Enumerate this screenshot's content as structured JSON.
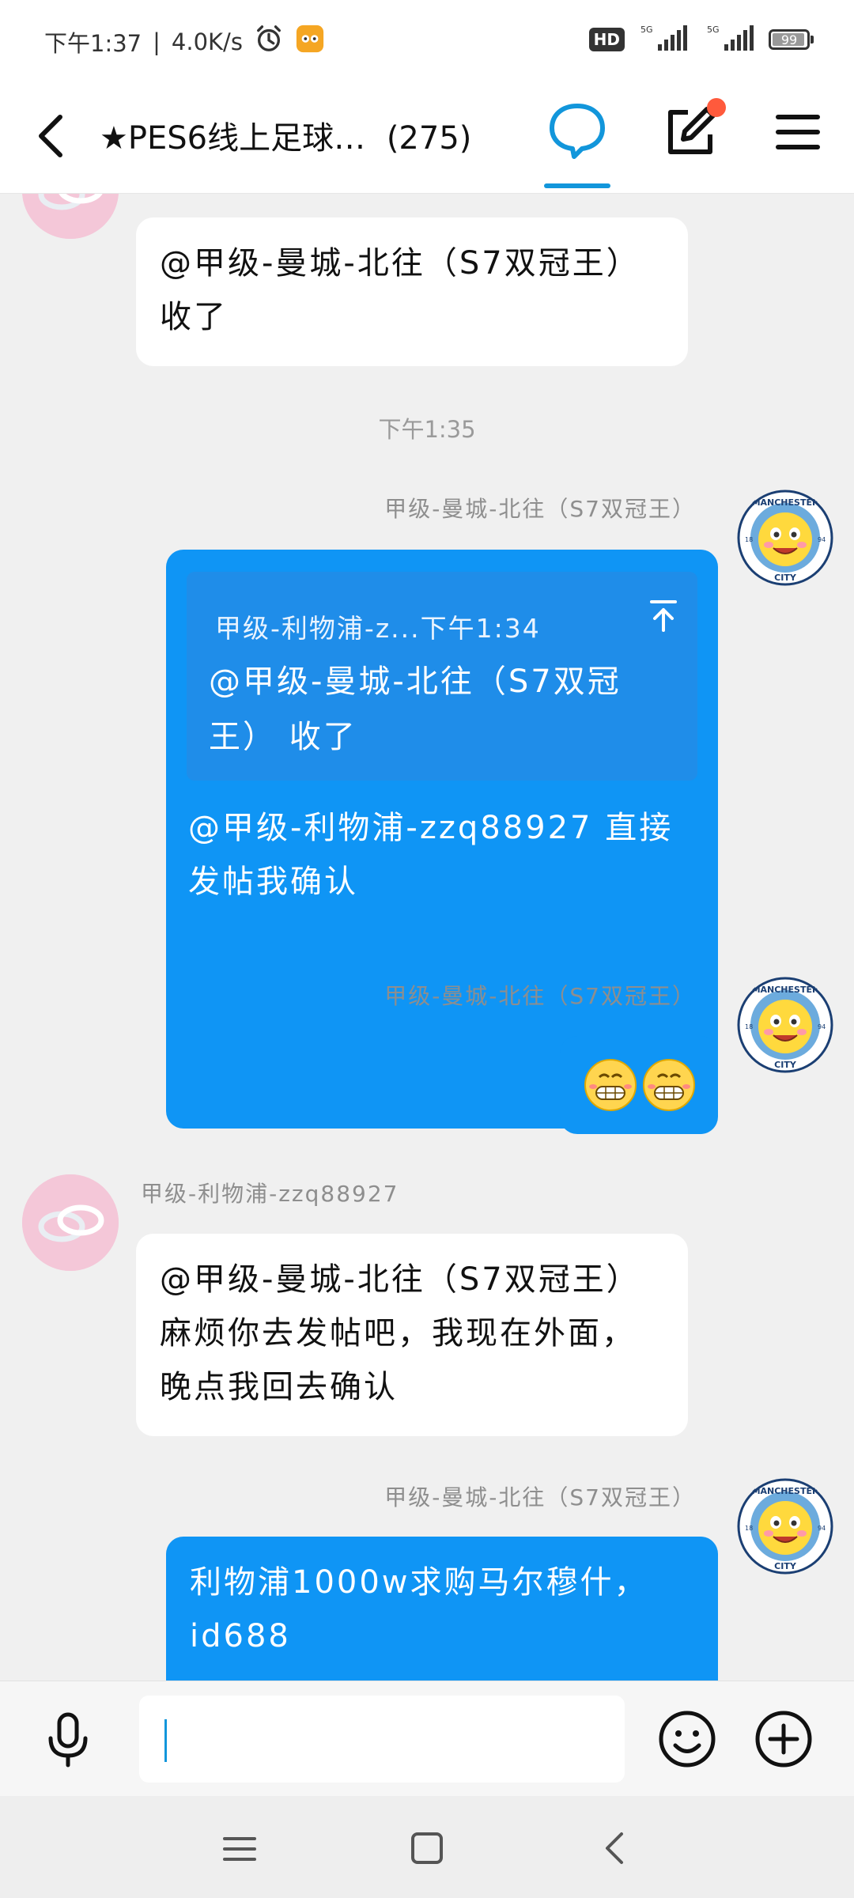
{
  "status_bar": {
    "time": "下午1:37",
    "separator": "|",
    "net_speed": "4.0K/s",
    "hd_label": "HD",
    "sig1_label": "5G",
    "sig2_label": "5G",
    "battery": "99"
  },
  "header": {
    "title": "★PES6线上足球…",
    "member_count": "(275)"
  },
  "messages": {
    "m1": {
      "text": "@甲级-曼城-北往（S7双冠王） 收了"
    },
    "time_divider": "下午1:35",
    "m2": {
      "sender": "甲级-曼城-北往（S7双冠王）",
      "quote_meta": "甲级-利物浦-z...下午1:34",
      "quote_text": "@甲级-曼城-北往（S7双冠王） 收了",
      "text": "@甲级-利物浦-zzq88927 直接发帖我确认"
    },
    "m3": {
      "sender": "甲级-曼城-北往（S7双冠王）",
      "emoji": "grinning-emoji"
    },
    "m4": {
      "sender": "甲级-利物浦-zzq88927",
      "text": "@甲级-曼城-北往（S7双冠王） 麻烦你去发帖吧，我现在外面，晚点我回去确认"
    },
    "m5": {
      "sender": "甲级-曼城-北往（S7双冠王）",
      "text": "利物浦1000w求购马尔穆什，id688"
    }
  },
  "avatars": {
    "city_top": "MANCHESTER",
    "city_bottom": "CITY",
    "city_year_left": "18",
    "city_year_right": "94"
  },
  "input": {
    "placeholder": ""
  },
  "colors": {
    "accent": "#1296db",
    "bubble_out": "#0f95f5",
    "bubble_in": "#ffffff",
    "background": "#f0f0f0",
    "notify": "#ff5a3c"
  },
  "icons": [
    "alarm-icon",
    "app-icon",
    "signal-icon",
    "battery-icon",
    "back-icon",
    "chat-bubble-icon",
    "compose-icon",
    "menu-icon",
    "arrow-up-to-top-icon",
    "microphone-icon",
    "emoji-icon",
    "plus-circle-icon",
    "nav-menu-icon",
    "nav-home-icon",
    "nav-back-icon"
  ]
}
